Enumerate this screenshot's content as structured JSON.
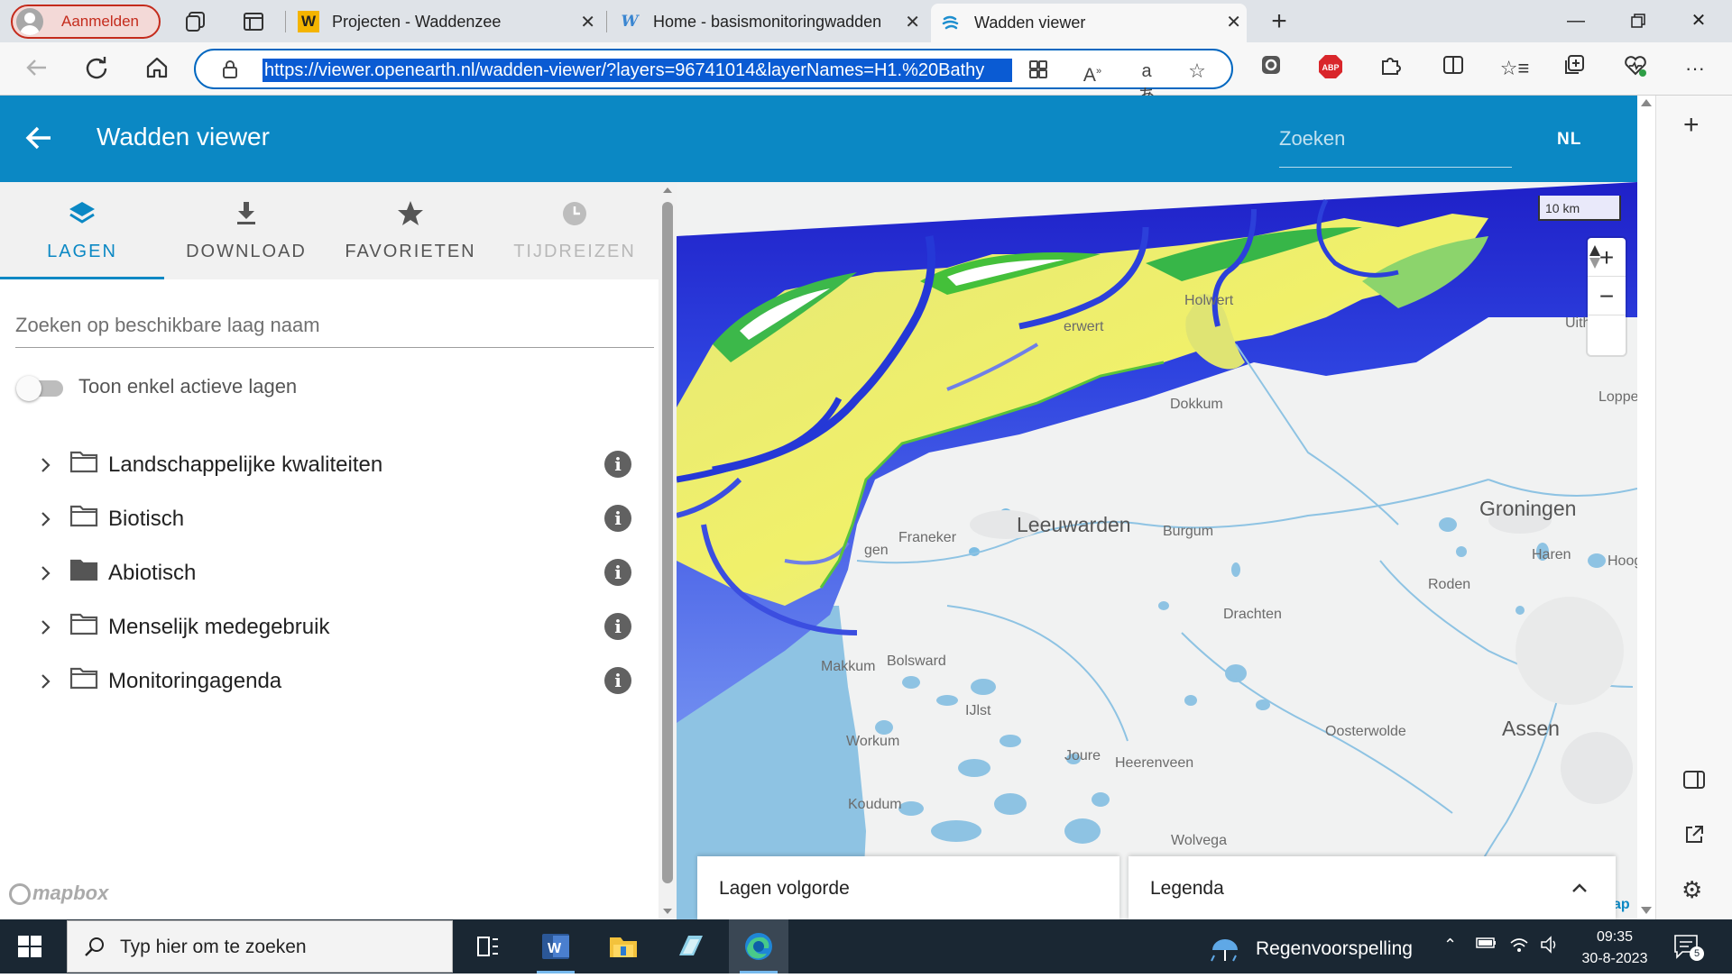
{
  "browser": {
    "profile_label": "Aanmelden",
    "tabs": [
      {
        "favicon": "W",
        "title": "Projecten - Waddenzee"
      },
      {
        "favicon": "W",
        "title": "Home - basismonitoringwadden"
      },
      {
        "favicon": "wave",
        "title": "Wadden viewer"
      }
    ],
    "url": "https://viewer.openearth.nl/wadden-viewer/?layers=96741014&layerNames=H1.%20Bathy",
    "extension_badge": "ABP",
    "icons": [
      "profile-icon",
      "workspaces-icon",
      "tab-actions-icon",
      "back-icon",
      "refresh-icon",
      "home-icon",
      "lock-icon",
      "app-icon",
      "read-aloud-icon",
      "translate-icon",
      "favorite-star-icon",
      "extensions-icon",
      "split-screen-icon",
      "favorites-icon",
      "collections-icon",
      "performance-icon",
      "more-icon"
    ]
  },
  "app": {
    "title": "Wadden viewer",
    "search_placeholder": "Zoeken",
    "language": "NL"
  },
  "panel": {
    "tabs": [
      {
        "label": "LAGEN",
        "icon": "layers-icon",
        "state": "active"
      },
      {
        "label": "DOWNLOAD",
        "icon": "download-icon",
        "state": "normal"
      },
      {
        "label": "FAVORIETEN",
        "icon": "star-icon",
        "state": "normal"
      },
      {
        "label": "TIJDREIZEN",
        "icon": "clock-icon",
        "state": "disabled"
      }
    ],
    "search_placeholder": "Zoeken op beschikbare laag naam",
    "toggle_label": "Toon enkel actieve lagen",
    "toggle_on": false,
    "folders": [
      {
        "name": "Landschappelijke kwaliteiten",
        "filled": false
      },
      {
        "name": "Biotisch",
        "filled": false
      },
      {
        "name": "Abiotisch",
        "filled": true
      },
      {
        "name": "Menselijk medegebruik",
        "filled": false
      },
      {
        "name": "Monitoringagenda",
        "filled": false
      }
    ]
  },
  "map": {
    "scale_label": "10 km",
    "zoom_in": "+",
    "zoom_out": "−",
    "places": [
      "Leeuwarden",
      "Groningen",
      "Franeker",
      "Dokkum",
      "Burgum",
      "Drachten",
      "Haren",
      "Roden",
      "Bolsward",
      "Makkum",
      "Workum",
      "IJlst",
      "Joure",
      "Heerenveen",
      "Koudum",
      "Oosterwolde",
      "Assen",
      "Wolvega",
      "Holwert",
      "erwert",
      "Uith",
      "Loppe",
      "Hoog",
      "gen",
      "Drachten"
    ],
    "attribution": "mapbox",
    "attribution_tail": "ap"
  },
  "bottom": {
    "layers_order": "Lagen volgorde",
    "legend": "Legenda"
  },
  "taskbar": {
    "search_placeholder": "Typ hier om te zoeken",
    "weather": "Regenvoorspelling",
    "time": "09:35",
    "date": "30-8-2023",
    "notifications": "5"
  },
  "colors": {
    "header": "#0b88c4",
    "accent": "#0b88c4",
    "url_highlight": "#0a5bd3",
    "taskbar": "#1a2733"
  }
}
